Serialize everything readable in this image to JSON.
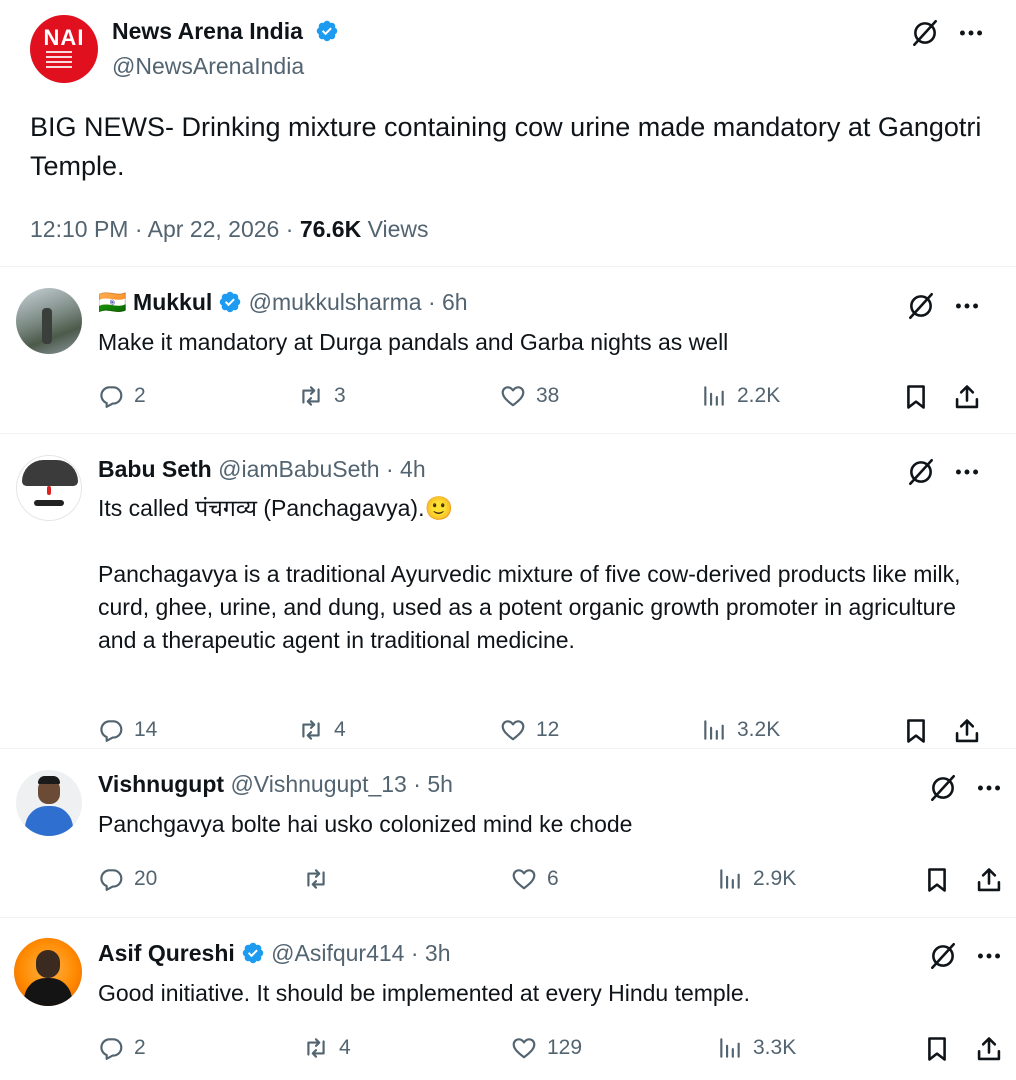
{
  "main_post": {
    "name": "News Arena India",
    "handle": "@NewsArenaIndia",
    "logo_text": "NAI",
    "text": "BIG NEWS- Drinking mixture containing cow urine made mandatory at Gangotri Temple.",
    "time": "12:10 PM",
    "date": "Apr 22, 2026",
    "views_count": "76.6K",
    "views_label": "Views"
  },
  "replies": [
    {
      "name": "Mukkul",
      "flag": "🇮🇳",
      "verified": true,
      "handle": "@mukkulsharma",
      "age": "6h",
      "text": "Make it mandatory at Durga pandals and Garba nights as well",
      "replies": "2",
      "reposts": "3",
      "likes": "38",
      "views": "2.2K"
    },
    {
      "name": "Babu Seth",
      "verified": false,
      "handle": "@iamBabuSeth",
      "age": "4h",
      "text": "Its called पंचगव्य (Panchagavya).🙂\n\nPanchagavya is a traditional Ayurvedic mixture of five cow-derived products like milk, curd, ghee, urine, and dung, used as a potent organic growth promoter in agriculture and a therapeutic agent in traditional medicine.",
      "replies": "14",
      "reposts": "4",
      "likes": "12",
      "views": "3.2K"
    },
    {
      "name": "Vishnugupt",
      "verified": false,
      "handle": "@Vishnugupt_13",
      "age": "5h",
      "text": "Panchgavya bolte hai usko colonized mind ke chode",
      "replies": "20",
      "reposts": "",
      "likes": "6",
      "views": "2.9K"
    },
    {
      "name": "Asif Qureshi",
      "verified": true,
      "handle": "@Asifqur414",
      "age": "3h",
      "text": "Good initiative. It should be implemented at every Hindu temple.",
      "replies": "2",
      "reposts": "4",
      "likes": "129",
      "views": "3.3K"
    }
  ],
  "dot": "·",
  "colors": {
    "verified": "#1d9bf0",
    "muted": "#536471",
    "logo_red": "#e0101f"
  },
  "icons": [
    "grok-icon",
    "more-icon",
    "reply-icon",
    "repost-icon",
    "like-icon",
    "views-icon",
    "bookmark-icon",
    "share-icon",
    "verified-badge-icon"
  ]
}
